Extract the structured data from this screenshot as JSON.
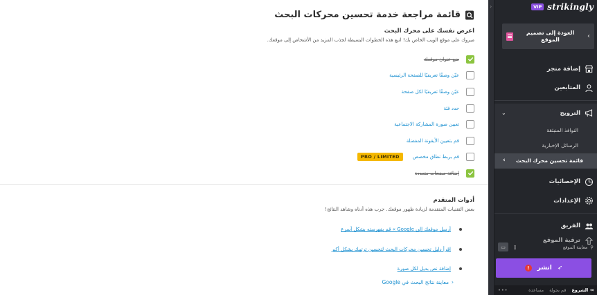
{
  "main": {
    "title": "قائمة مراجعة خدمة تحسين محركات البحث",
    "section_heading": "اعرض نفسك على محرك البحث",
    "section_desc": "مبروك على موقع الويب الخاص بك! اتبع هذه الخطوات البسيطة لجذب المزيد من الأشخاص إلى موقعك.",
    "tasks": [
      {
        "label": "ضع عنوان موقعك",
        "done": true
      },
      {
        "label": "عيّن وصفًا تعريفيًا للصفحة الرئيسية",
        "done": false
      },
      {
        "label": "عيّن وصفًا تعريفيًا لكل صفحة",
        "done": false
      },
      {
        "label": "حدد فئة",
        "done": false
      },
      {
        "label": "تعيين صورة المشاركة الاجتماعية",
        "done": false
      },
      {
        "label": "قم بتعيين الأيقونة المفضلة",
        "done": false
      },
      {
        "label": "قم بربط نطاق مخصص",
        "done": false,
        "badge": "PRO / LIMITED"
      },
      {
        "label": "إضافة صفحات متعددة",
        "done": true
      }
    ],
    "advanced_heading": "أدوات المتقدم",
    "advanced_desc": "بعض التقنيات المتقدمة لزيادة ظهور موقعك. جرب هذه أدناه وشاهد النتائج!",
    "advanced_links": [
      "أرسل موقعك إلى Google » قم بفهرسته بشكل أسرع",
      "اقرأ دليل تحسين محركات البحث لتحسين ترتيبك بشكل أكبر",
      "إضافة نص بديل لكل صورة"
    ],
    "preview_link": "معاينة نتائج البحث في Google"
  },
  "sidebar": {
    "brand": "strikingly",
    "vip": "VIP",
    "back_label": "العودة إلى تصميم الموقع",
    "nav": [
      {
        "label": "إضافة متجر",
        "icon": "store-icon"
      },
      {
        "label": "المتابعين",
        "icon": "followers-icon"
      },
      {
        "label": "الترويج",
        "icon": "megaphone-icon",
        "expanded": true
      }
    ],
    "promo_sub": [
      {
        "label": "النوافذ المنبثقة"
      },
      {
        "label": "الرسائل الإخبارية"
      },
      {
        "label": "قائمة تحسين محرك البحث",
        "active": true
      }
    ],
    "nav2": [
      {
        "label": "الإحصائيات",
        "icon": "pie-chart-icon"
      },
      {
        "label": "الإعدادات",
        "icon": "gear-icon"
      }
    ],
    "nav3": [
      {
        "label": "الفريق",
        "icon": "team-icon"
      },
      {
        "label": "ترقية الموقع",
        "icon": "upgrade-icon"
      }
    ],
    "preview_label": "معاينة الموقع",
    "publish_label": "انشر",
    "bottom": {
      "start": "الشروع",
      "tour": "قم بجولة",
      "help": "مساعدة"
    }
  },
  "colors": {
    "accent": "#8b4fe3",
    "link": "#1a8fd0",
    "check": "#8bc43f",
    "badge": "#f5b800",
    "sidebar_bg": "#24262b"
  }
}
